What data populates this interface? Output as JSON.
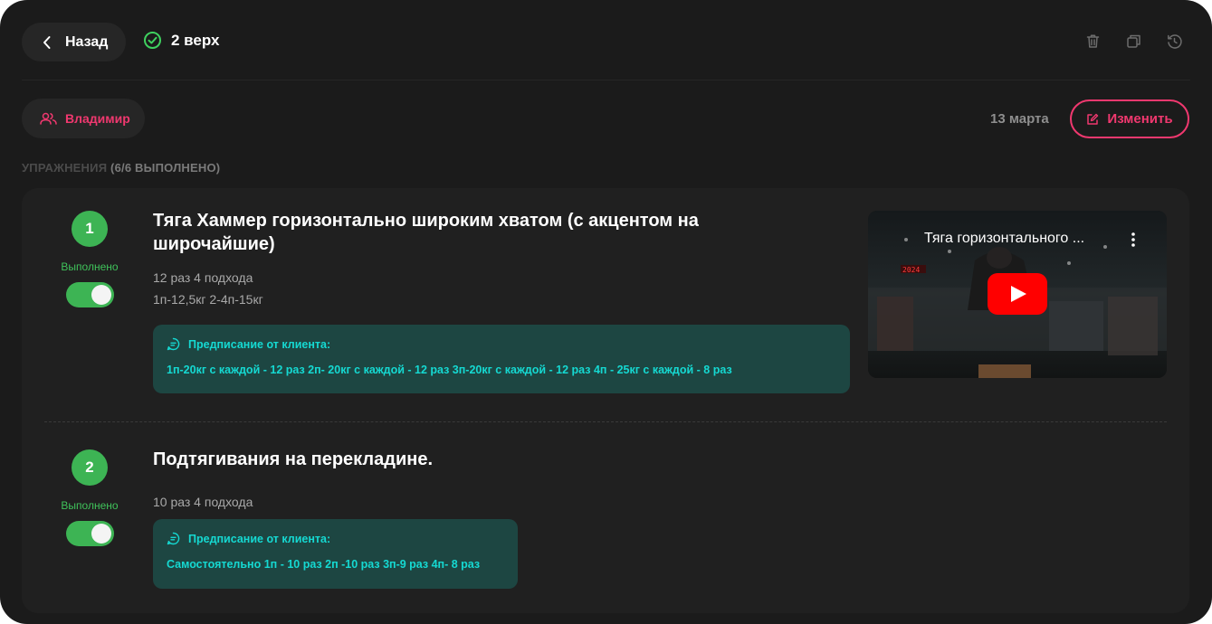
{
  "header": {
    "back_label": "Назад",
    "title": "2 верх"
  },
  "subbar": {
    "client_name": "Владимир",
    "date": "13 марта",
    "edit_label": "Изменить"
  },
  "section": {
    "label": "УПРАЖНЕНИЯ",
    "progress": "(6/6 ВЫПОЛНЕНО)"
  },
  "exercises": [
    {
      "number": "1",
      "status": "Выполнено",
      "done": true,
      "title_line1": "Тяга Хаммер горизонтально широким хватом (с акцентом на",
      "title_line2": "широчайшие)",
      "reps": "12 раз 4 подхода",
      "weights": "1п-12,5кг 2-4п-15кг",
      "note_title": "Предписание от клиента:",
      "note_text": "1п-20кг с каждой - 12 раз 2п- 20кг с каждой - 12 раз 3п-20кг с каждой - 12 раз 4п - 25кг с каждой - 8 раз",
      "video_title": "Тяга горизонтального ..."
    },
    {
      "number": "2",
      "status": "Выполнено",
      "done": true,
      "title": "Подтягивания на перекладине.",
      "reps": "10 раз 4 подхода",
      "note_title": "Предписание от клиента:",
      "note_text": "Самостоятельно 1п - 10 раз 2п -10 раз 3п-9 раз 4п- 8 раз"
    }
  ],
  "colors": {
    "background": "#1b1b1b",
    "card": "#202020",
    "accent_pink": "#f0386f",
    "success_green": "#3db454",
    "note_bg": "#1d4642",
    "note_text": "#15d9d2"
  },
  "icons": [
    "chevron-left-icon",
    "check-circle-icon",
    "trash-icon",
    "copy-icon",
    "history-icon",
    "users-icon",
    "edit-icon",
    "comment-icon",
    "play-icon",
    "more-vertical-icon"
  ]
}
